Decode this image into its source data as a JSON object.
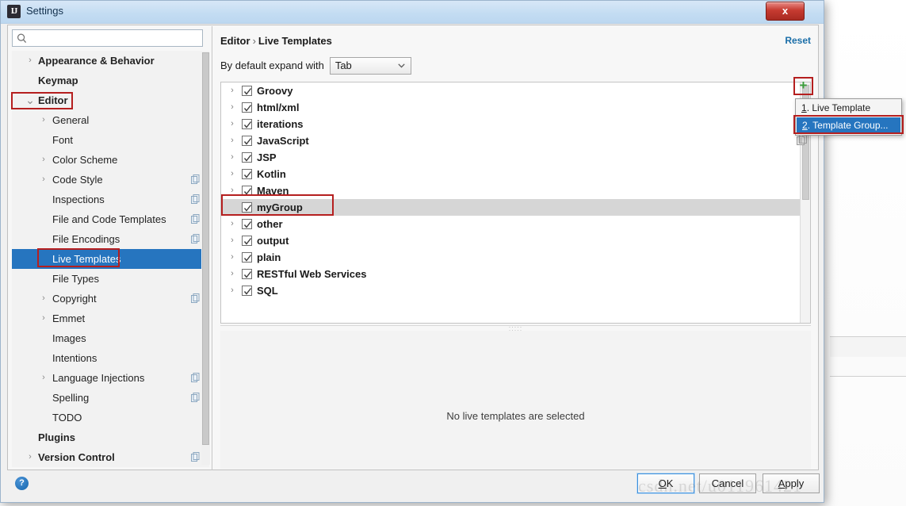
{
  "window": {
    "title": "Settings",
    "icon": "intellij-idea-icon",
    "close_label": "x"
  },
  "search": {
    "value": "",
    "placeholder": "",
    "icon": "search-icon"
  },
  "sidebar": {
    "items": [
      {
        "label": "Appearance & Behavior",
        "level": 0,
        "arrow": "collapsed",
        "copy": false,
        "selected": false
      },
      {
        "label": "Keymap",
        "level": 0,
        "arrow": "none",
        "copy": false,
        "selected": false
      },
      {
        "label": "Editor",
        "level": 0,
        "arrow": "expanded",
        "copy": false,
        "selected": false
      },
      {
        "label": "General",
        "level": 1,
        "arrow": "collapsed",
        "copy": false,
        "selected": false
      },
      {
        "label": "Font",
        "level": 1,
        "arrow": "none",
        "copy": false,
        "selected": false
      },
      {
        "label": "Color Scheme",
        "level": 1,
        "arrow": "collapsed",
        "copy": false,
        "selected": false
      },
      {
        "label": "Code Style",
        "level": 1,
        "arrow": "collapsed",
        "copy": true,
        "selected": false
      },
      {
        "label": "Inspections",
        "level": 1,
        "arrow": "none",
        "copy": true,
        "selected": false
      },
      {
        "label": "File and Code Templates",
        "level": 1,
        "arrow": "none",
        "copy": true,
        "selected": false
      },
      {
        "label": "File Encodings",
        "level": 1,
        "arrow": "none",
        "copy": true,
        "selected": false
      },
      {
        "label": "Live Templates",
        "level": 1,
        "arrow": "none",
        "copy": false,
        "selected": true
      },
      {
        "label": "File Types",
        "level": 1,
        "arrow": "none",
        "copy": false,
        "selected": false
      },
      {
        "label": "Copyright",
        "level": 1,
        "arrow": "collapsed",
        "copy": true,
        "selected": false
      },
      {
        "label": "Emmet",
        "level": 1,
        "arrow": "collapsed",
        "copy": false,
        "selected": false
      },
      {
        "label": "Images",
        "level": 1,
        "arrow": "none",
        "copy": false,
        "selected": false
      },
      {
        "label": "Intentions",
        "level": 1,
        "arrow": "none",
        "copy": false,
        "selected": false
      },
      {
        "label": "Language Injections",
        "level": 1,
        "arrow": "collapsed",
        "copy": true,
        "selected": false
      },
      {
        "label": "Spelling",
        "level": 1,
        "arrow": "none",
        "copy": true,
        "selected": false
      },
      {
        "label": "TODO",
        "level": 1,
        "arrow": "none",
        "copy": false,
        "selected": false
      },
      {
        "label": "Plugins",
        "level": 0,
        "arrow": "none",
        "copy": false,
        "selected": false
      },
      {
        "label": "Version Control",
        "level": 0,
        "arrow": "collapsed",
        "copy": true,
        "selected": false
      }
    ]
  },
  "main": {
    "breadcrumb": {
      "parent": "Editor",
      "separator": "›",
      "current": "Live Templates"
    },
    "reset_label": "Reset",
    "expand_with": {
      "label": "By default expand with",
      "value": "Tab"
    },
    "templates": [
      {
        "label": "Groovy",
        "checked": true,
        "expandable": true,
        "selected": false
      },
      {
        "label": "html/xml",
        "checked": true,
        "expandable": true,
        "selected": false
      },
      {
        "label": "iterations",
        "checked": true,
        "expandable": true,
        "selected": false
      },
      {
        "label": "JavaScript",
        "checked": true,
        "expandable": true,
        "selected": false
      },
      {
        "label": "JSP",
        "checked": true,
        "expandable": true,
        "selected": false
      },
      {
        "label": "Kotlin",
        "checked": true,
        "expandable": true,
        "selected": false
      },
      {
        "label": "Maven",
        "checked": true,
        "expandable": true,
        "selected": false
      },
      {
        "label": "myGroup",
        "checked": true,
        "expandable": false,
        "selected": true
      },
      {
        "label": "other",
        "checked": true,
        "expandable": true,
        "selected": false
      },
      {
        "label": "output",
        "checked": true,
        "expandable": true,
        "selected": false
      },
      {
        "label": "plain",
        "checked": true,
        "expandable": true,
        "selected": false
      },
      {
        "label": "RESTful Web Services",
        "checked": true,
        "expandable": true,
        "selected": false
      },
      {
        "label": "SQL",
        "checked": true,
        "expandable": true,
        "selected": false
      }
    ],
    "empty_message": "No live templates are selected"
  },
  "toolbar": {
    "add_label": "+",
    "add_icon": "plus-icon",
    "copy_icon": "copy-icon"
  },
  "popup": {
    "items": [
      {
        "mnemonic": "1",
        "label": ". Live Template",
        "highlighted": false
      },
      {
        "mnemonic": "2",
        "label": ". Template Group...",
        "highlighted": true
      }
    ]
  },
  "footer": {
    "help_label": "?",
    "ok_mnemonic": "O",
    "ok_rest": "K",
    "cancel_label": "Cancel",
    "apply_mnemonic": "A",
    "apply_rest": "pply"
  },
  "watermark": {
    "text": "csdn.net/u011961421"
  },
  "colors": {
    "accent_selection": "#2675bf",
    "annotation_red": "#b51f1f",
    "add_green": "#3a9d3a",
    "link_blue": "#1a6ea8"
  }
}
